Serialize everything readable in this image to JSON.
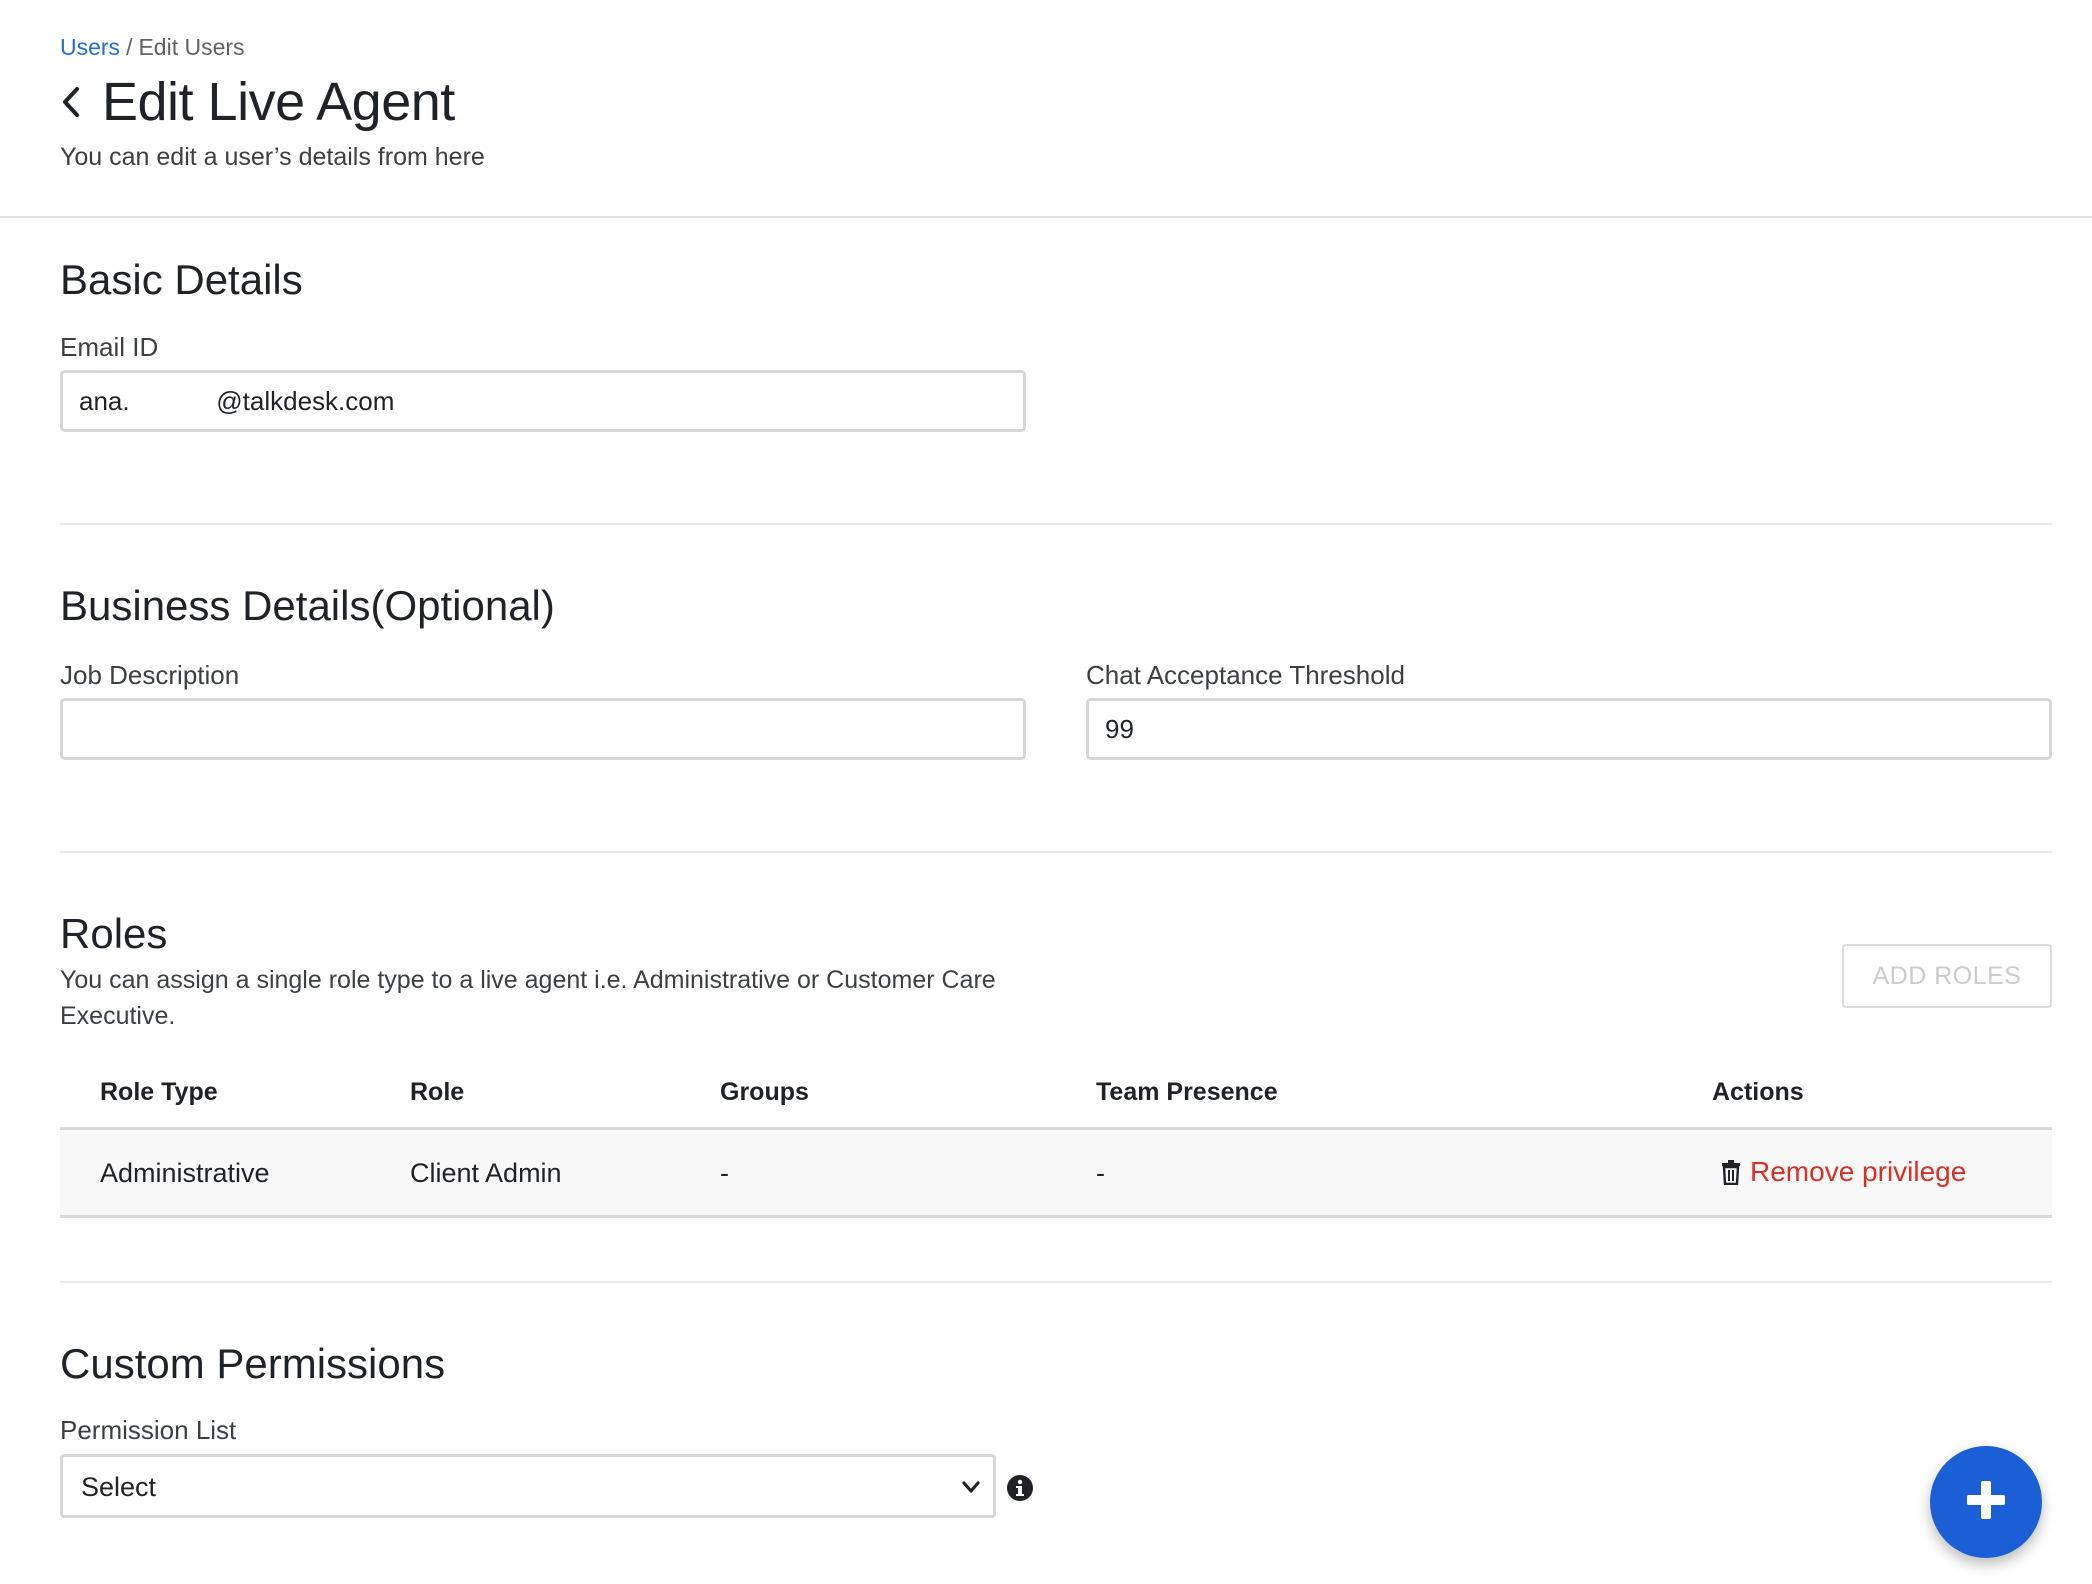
{
  "breadcrumb": {
    "parent": "Users",
    "separator": "/",
    "current": "Edit Users"
  },
  "header": {
    "title": "Edit Live Agent",
    "subtitle": "You can edit a user’s details from here"
  },
  "basic_details": {
    "title": "Basic Details",
    "email_label": "Email ID",
    "email_value": "ana.            @talkdesk.com"
  },
  "business_details": {
    "title": "Business Details(Optional)",
    "job_label": "Job Description",
    "job_value": "",
    "threshold_label": "Chat Acceptance Threshold",
    "threshold_value": "99"
  },
  "roles": {
    "title": "Roles",
    "description": "You can assign a single role type to a live agent i.e. Administrative or Customer Care Executive.",
    "add_button": "ADD ROLES",
    "columns": [
      "Role Type",
      "Role",
      "Groups",
      "Team Presence",
      "Actions"
    ],
    "rows": [
      {
        "role_type": "Administrative",
        "role": "Client Admin",
        "groups": "-",
        "team_presence": "-",
        "action": "Remove privilege"
      }
    ]
  },
  "custom_permissions": {
    "title": "Custom Permissions",
    "list_label": "Permission List",
    "select_value": "Select"
  },
  "icons": {
    "back": "chevron-left-icon",
    "trash": "trash-icon",
    "dropdown": "chevron-down-icon",
    "info": "info-icon",
    "fab": "plus-icon"
  },
  "colors": {
    "link": "#1f6fd1",
    "danger": "#d93025",
    "fab": "#1a5fd6"
  }
}
